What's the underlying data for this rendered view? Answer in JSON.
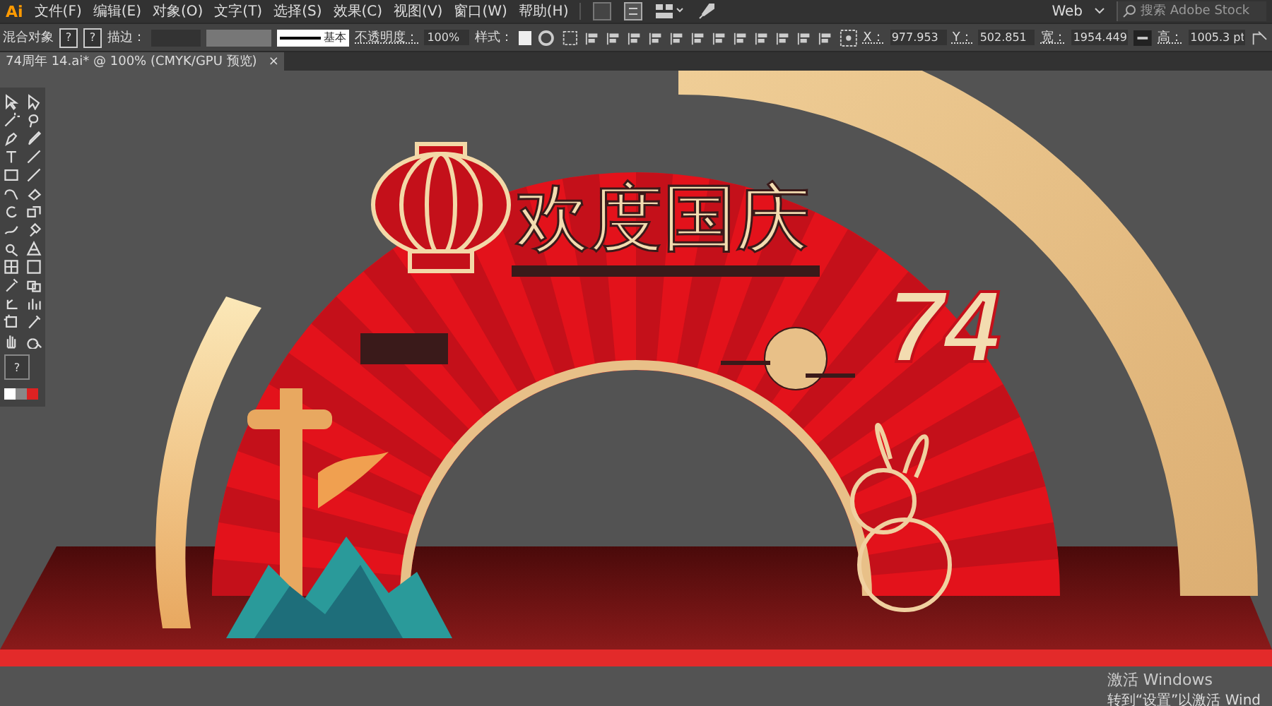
{
  "app": {
    "logo": "Ai"
  },
  "menu": [
    "文件(F)",
    "编辑(E)",
    "对象(O)",
    "文字(T)",
    "选择(S)",
    "效果(C)",
    "视图(V)",
    "窗口(W)",
    "帮助(H)"
  ],
  "workspace": {
    "label": "Web"
  },
  "search": {
    "placeholder": "搜索 Adobe Stock"
  },
  "tools_panel": {
    "fill_stroke": "?"
  },
  "control_bar": {
    "selection": "混合对象",
    "fill_swatch": "?",
    "stroke_swatch": "?",
    "stroke_label": "描边：",
    "stroke_style": "基本",
    "opacity_label": "不透明度：",
    "opacity": "100%",
    "style_label": "样式：",
    "fields": [
      {
        "label": "X：",
        "value": "977.953"
      },
      {
        "label": "Y：",
        "value": "502.851"
      },
      {
        "label": "宽：",
        "value": "1954.449"
      },
      {
        "label": "高：",
        "value": "1005.3 pt"
      }
    ]
  },
  "document_tab": {
    "title": "74周年 14.ai* @ 100% (CMYK/GPU 预览)",
    "close": "×"
  },
  "artwork": {
    "headline": "欢度国庆",
    "number": "74"
  },
  "activation": {
    "title": "激活 Windows",
    "subtitle": "转到“设置”以激活 Wind"
  }
}
